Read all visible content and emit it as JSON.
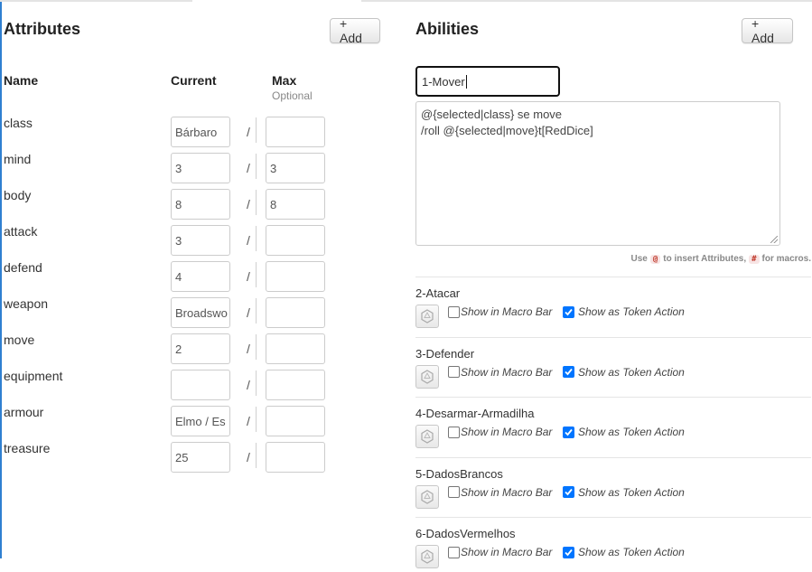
{
  "attributes": {
    "title": "Attributes",
    "add_label": "+ Add",
    "col_name": "Name",
    "col_current": "Current",
    "col_max": "Max",
    "col_max_hint": "Optional",
    "separator": "/",
    "rows": [
      {
        "name": "class",
        "current": "Bárbaro",
        "max": ""
      },
      {
        "name": "mind",
        "current": "3",
        "max": "3"
      },
      {
        "name": "body",
        "current": "8",
        "max": "8"
      },
      {
        "name": "attack",
        "current": "3",
        "max": ""
      },
      {
        "name": "defend",
        "current": "4",
        "max": ""
      },
      {
        "name": "weapon",
        "current": "Broadswo",
        "max": ""
      },
      {
        "name": "move",
        "current": "2",
        "max": ""
      },
      {
        "name": "equipment",
        "current": "",
        "max": ""
      },
      {
        "name": "armour",
        "current": "Elmo / Es",
        "max": ""
      },
      {
        "name": "treasure",
        "current": "25",
        "max": ""
      }
    ]
  },
  "abilities": {
    "title": "Abilities",
    "add_label": "+ Add",
    "editing": {
      "name": "1-Mover",
      "macro_line1": "@{selected|class} se move",
      "macro_line2": "/roll @{selected|move}t[RedDice]"
    },
    "hint": {
      "use": "Use",
      "at_chip": "@",
      "to_attrs": "to insert Attributes,",
      "hash_chip": "#",
      "for_macros": "for macros."
    },
    "macro_bar_label": "Show in Macro Bar",
    "token_action_label": "Show as Token Action",
    "items": [
      {
        "label": "2-Atacar",
        "macro_bar": false,
        "token_action": true
      },
      {
        "label": "3-Defender",
        "macro_bar": false,
        "token_action": true
      },
      {
        "label": "4-Desarmar-Armadilha",
        "macro_bar": false,
        "token_action": true
      },
      {
        "label": "5-DadosBrancos",
        "macro_bar": false,
        "token_action": true
      },
      {
        "label": "6-DadosVermelhos",
        "macro_bar": false,
        "token_action": true
      }
    ]
  },
  "colors": {
    "accent": "#0075ff",
    "left_edge": "#2f80d1",
    "chip_bg": "#f7e4e4",
    "chip_text": "#c0392b"
  },
  "icons": {
    "ability_icon": "dice-icon",
    "checkbox_checked": "checkmark-icon"
  }
}
